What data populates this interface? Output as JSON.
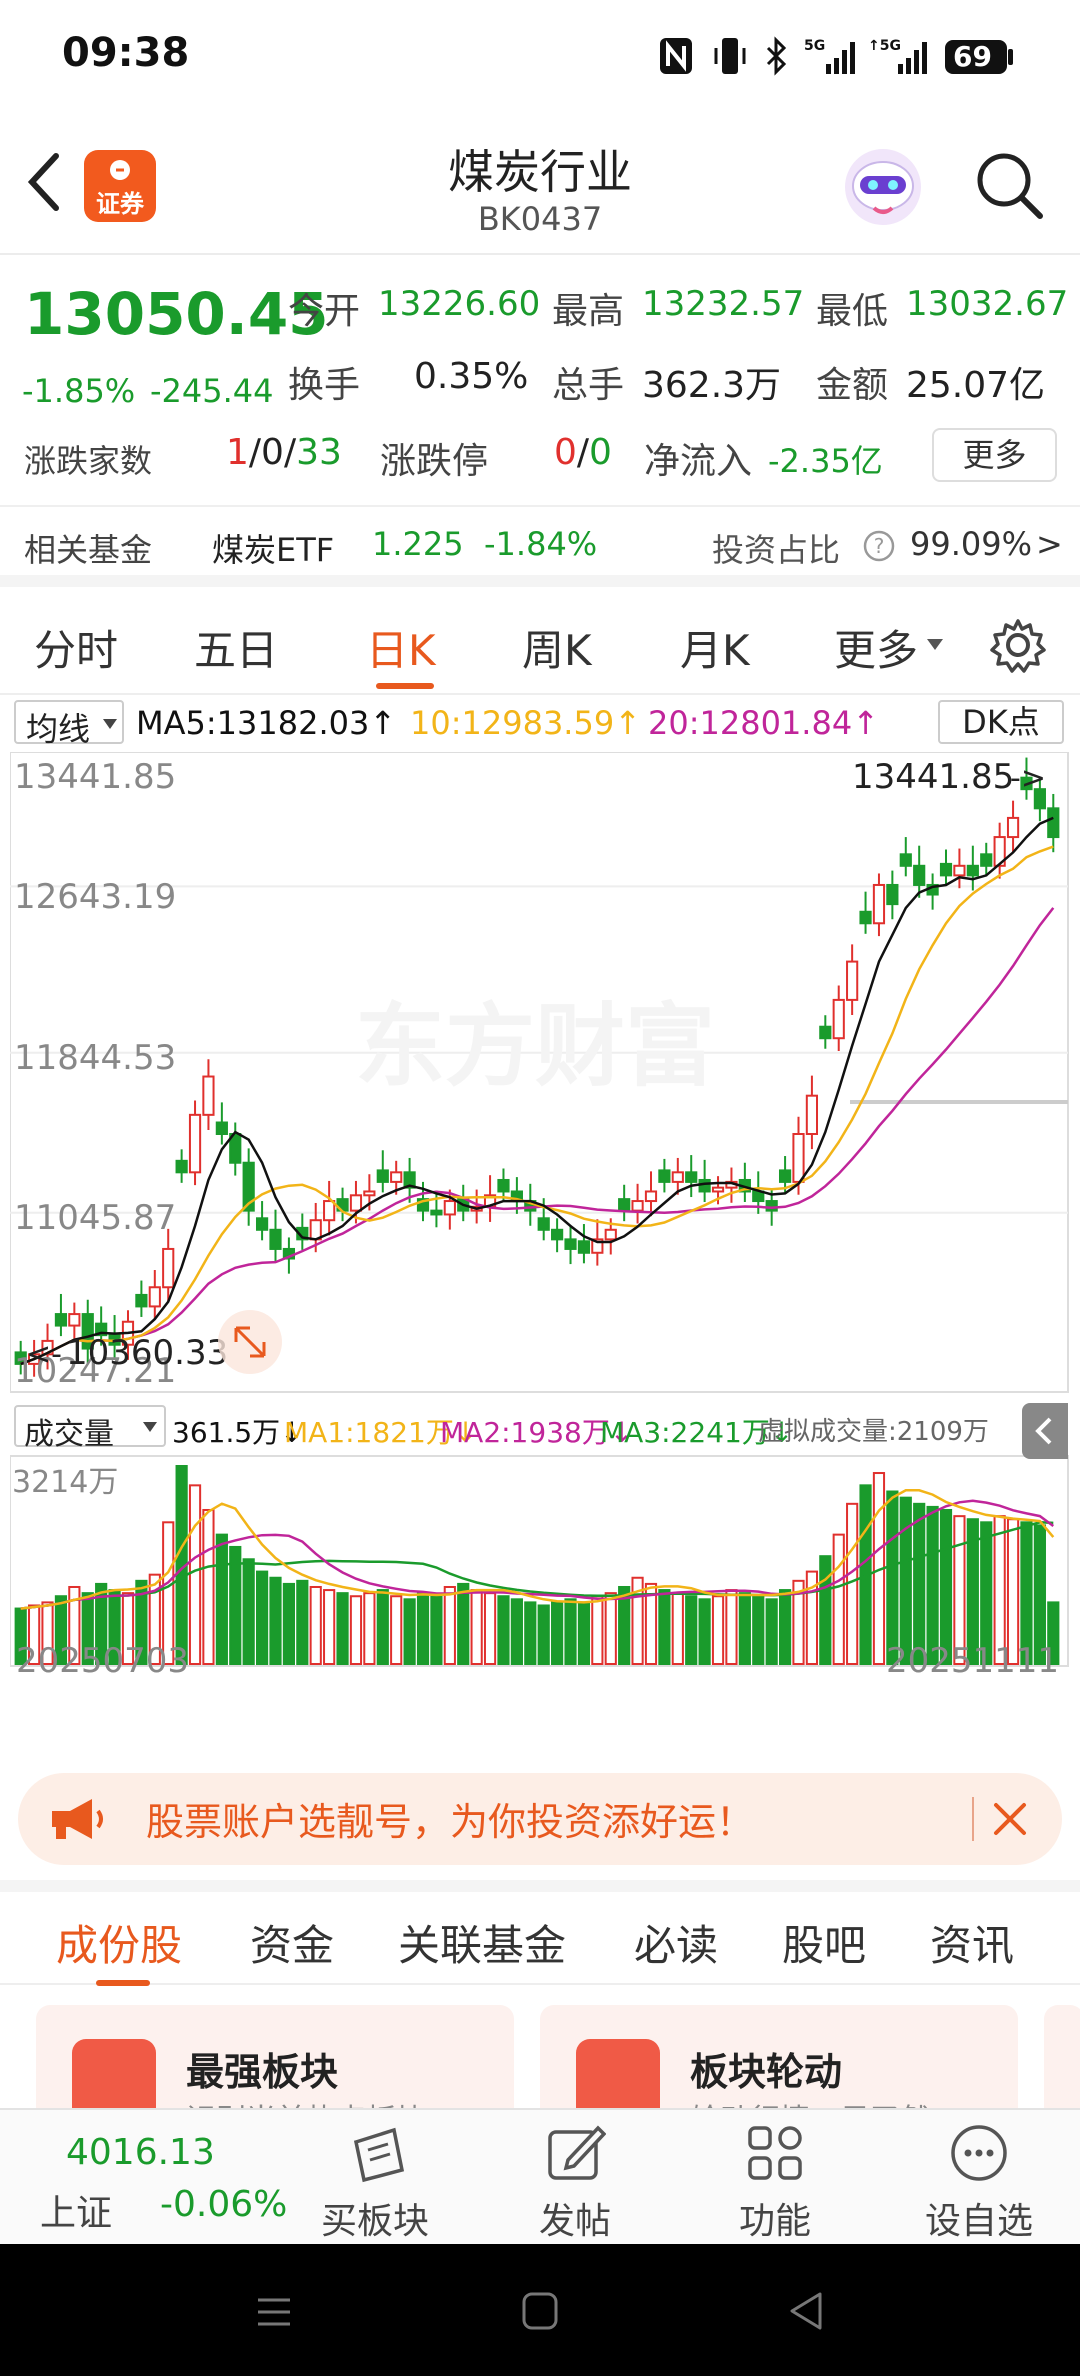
{
  "status_bar": {
    "time": "09:38",
    "battery": "69"
  },
  "header": {
    "title": "煤炭行业",
    "code": "BK0437",
    "logo_text": "证券"
  },
  "quote": {
    "price": "13050.45",
    "change_pct": "-1.85%",
    "change": "-245.44",
    "open_label": "今开",
    "open": "13226.60",
    "high_label": "最高",
    "high": "13232.57",
    "low_label": "最低",
    "low": "13032.67",
    "turnover_label": "换手",
    "turnover": "0.35%",
    "volume_label": "总手",
    "volume": "362.3万",
    "amount_label": "金额",
    "amount": "25.07亿",
    "breadth_label": "涨跌家数",
    "breadth_up": "1",
    "breadth_sep1": "/",
    "breadth_flat": "0",
    "breadth_sep2": "/",
    "breadth_down": "33",
    "limit_label": "涨跌停",
    "limit_up": "0",
    "limit_sep": "/",
    "limit_down": "0",
    "inflow_label": "净流入",
    "inflow": "-2.35亿",
    "more": "更多"
  },
  "fund": {
    "label": "相关基金",
    "name": "煤炭ETF",
    "price": "1.225",
    "change": "-1.84%",
    "ratio_label": "投资占比",
    "ratio": "99.09%",
    "arrow": ">"
  },
  "period_tabs": [
    "分时",
    "五日",
    "日K",
    "周K",
    "月K",
    "更多"
  ],
  "active_period": "日K",
  "ma_legend": {
    "selector": "均线",
    "ma5": "MA5:13182.03↑",
    "ma10": "10:12983.59↑",
    "ma20": "20:12801.84↑",
    "dk": "DK点"
  },
  "chart_labels": {
    "y_ticks": [
      "13441.85",
      "12643.19",
      "11844.53",
      "11045.87",
      "10247.21"
    ],
    "max_marker": "13441.85",
    "min_marker": "10360.33",
    "vol_tick": "3214万",
    "start_date": "20250703",
    "end_date": "20251111",
    "watermark": "东方财富"
  },
  "vol_legend": {
    "selector": "成交量",
    "vol": "361.5万↓",
    "ma1": "MA1:1821万↓",
    "ma2": "MA2:1938万↓",
    "ma3": "MA3:2241万↓",
    "virtual": "虚拟成交量:2109万"
  },
  "colors": {
    "up": "#e0302d",
    "down": "#1a9b2c",
    "ma5": "#111111",
    "ma10": "#f2b418",
    "ma20": "#c0259a",
    "accent": "#e8591e"
  },
  "chart_data": {
    "type": "candlestick",
    "y_range": [
      10247.21,
      13441.85
    ],
    "x_range": [
      "20250703",
      "20251111"
    ],
    "high": 13441.85,
    "low": 10360.33,
    "ma5_last": 13182.03,
    "ma10_last": 12983.59,
    "ma20_last": 12801.84,
    "closes": [
      10300,
      10350,
      10420,
      10500,
      10560,
      10380,
      10450,
      10400,
      10520,
      10600,
      10700,
      10900,
      11300,
      11600,
      11800,
      11500,
      11350,
      11100,
      11000,
      10900,
      10850,
      10950,
      11050,
      11150,
      11100,
      11180,
      11200,
      11250,
      11300,
      11220,
      11100,
      11080,
      11150,
      11100,
      11120,
      11180,
      11200,
      11150,
      11100,
      11000,
      10950,
      10900,
      10880,
      10950,
      11000,
      11100,
      11150,
      11200,
      11250,
      11300,
      11250,
      11200,
      11220,
      11250,
      11200,
      11150,
      11100,
      11250,
      11500,
      11700,
      12000,
      12200,
      12400,
      12600,
      12800,
      12700,
      12900,
      12800,
      12750,
      12850,
      12900,
      12850,
      12900,
      13050,
      13150,
      13300,
      13200,
      13050
    ],
    "volume_max": 3214,
    "volume_unit": "万",
    "volumes": [
      900,
      950,
      1000,
      1100,
      1250,
      1150,
      1300,
      1200,
      1150,
      1350,
      1450,
      2300,
      3214,
      2900,
      2500,
      2100,
      1900,
      1700,
      1500,
      1400,
      1300,
      1350,
      1250,
      1200,
      1150,
      1100,
      1150,
      1200,
      1100,
      1050,
      1150,
      1100,
      1250,
      1300,
      1200,
      1150,
      1100,
      1050,
      1000,
      950,
      1000,
      1050,
      1000,
      1100,
      1150,
      1250,
      1400,
      1300,
      1200,
      1150,
      1100,
      1050,
      1100,
      1200,
      1150,
      1100,
      1050,
      1200,
      1350,
      1500,
      1750,
      2100,
      2600,
      2900,
      3100,
      2800,
      2700,
      2600,
      2550,
      2500,
      2400,
      2350,
      2300,
      2400,
      2350,
      2300,
      2250,
      1000
    ]
  },
  "banner": {
    "text": "股票账户选靓号，为你投资添好运！"
  },
  "section_tabs": [
    "成份股",
    "资金",
    "关联基金",
    "必读",
    "股吧",
    "资讯"
  ],
  "active_section": "成份股",
  "cards": [
    {
      "title": "最强板块",
      "subtitle": "识别当前热点板块"
    },
    {
      "title": "板块轮动",
      "subtitle": "轮动行情一目了然"
    }
  ],
  "bottom_nav": {
    "index_value": "4016.13",
    "index_name": "上证",
    "index_change": "-0.06%",
    "items": [
      "买板块",
      "发帖",
      "功能",
      "设自选"
    ]
  }
}
